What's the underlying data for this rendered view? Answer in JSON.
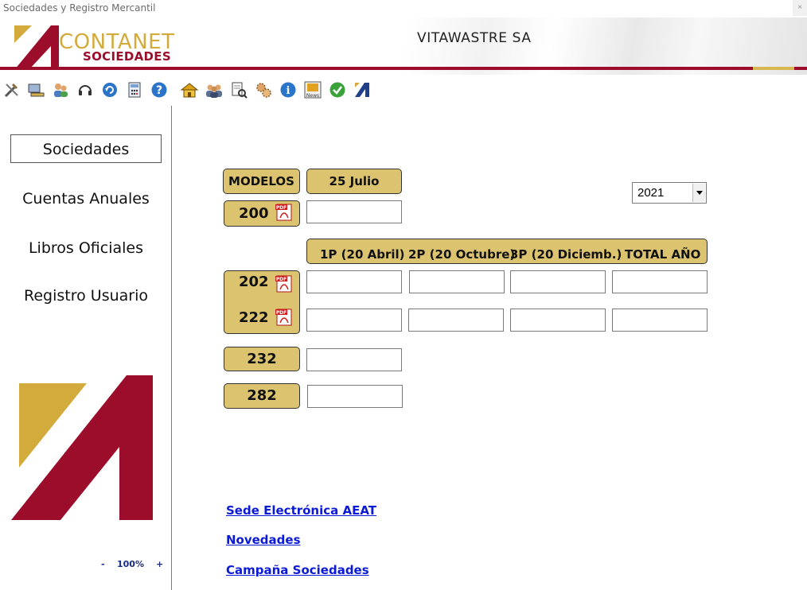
{
  "window": {
    "title": "Sociedades y Registro Mercantil",
    "close_label": "×"
  },
  "header": {
    "company": "VITAWASTRE SA",
    "logo_line1": "CONTANET",
    "logo_line2": "SOCIEDADES",
    "colors": {
      "brand_red": "#9c0d2b",
      "brand_gold": "#d3aa3c",
      "cell_gold": "#dcc36f"
    }
  },
  "toolbar": {
    "icons": [
      "tools-icon",
      "computer-icon",
      "users-icon",
      "headset-icon",
      "refresh-icon",
      "calculator-icon",
      "help-icon",
      "home-icon",
      "group-icon",
      "document-search-icon",
      "settings-icon",
      "info-icon",
      "news-icon",
      "check-icon",
      "brand-icon"
    ]
  },
  "sidebar": {
    "items": [
      {
        "label": "Sociedades",
        "active": true
      },
      {
        "label": "Cuentas Anuales",
        "active": false
      },
      {
        "label": "Libros Oficiales",
        "active": false
      },
      {
        "label": "Registro Usuario",
        "active": false
      }
    ],
    "zoom": {
      "minus": "-",
      "value": "100%",
      "plus": "+"
    }
  },
  "main": {
    "year": "2021",
    "modelos_label": "MODELOS",
    "date_header": "25 Julio",
    "columns": [
      "1P (20 Abril)",
      "2P (20 Octubre)",
      "3P (20 Diciemb.)",
      "TOTAL AÑO"
    ],
    "models": {
      "m200": "200",
      "m202": "202",
      "m222": "222",
      "m232": "232",
      "m282": "282"
    },
    "links": {
      "aeat": "Sede Electrónica AEAT",
      "novedades": "Novedades",
      "campana": "Campaña Sociedades"
    }
  }
}
